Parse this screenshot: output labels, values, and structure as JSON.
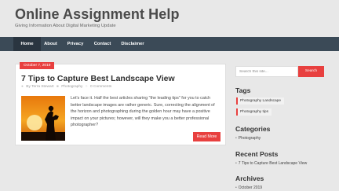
{
  "site": {
    "title": "Online Assignment Help",
    "description": "Giving Information About Digital Marketing Update"
  },
  "nav": {
    "items": [
      {
        "label": "Home"
      },
      {
        "label": "About"
      },
      {
        "label": "Privacy"
      },
      {
        "label": "Contact"
      },
      {
        "label": "Disclaimer"
      }
    ]
  },
  "post": {
    "date": "October 7, 2019",
    "title": "7 Tips to Capture Best Landscape View",
    "author": "By Terra Stewart",
    "category": "Photography",
    "comments": "0 Comments",
    "excerpt": "Let's face it. Half the best articles sharing \"the leading tips\" for you to catch better landscape images are rather generic. Sure, correcting the alignment of the horizon and photographing during the golden hour may have a positive impact on your pictures; however, will they make you a better professional photographer?",
    "read_more": "Read More"
  },
  "sidebar": {
    "search": {
      "placeholder": "Search this site...",
      "button": "Search"
    },
    "tags": {
      "title": "Tags",
      "items": [
        "Photography Landscape",
        "Photography tips"
      ]
    },
    "categories": {
      "title": "Categories",
      "items": [
        "Photography"
      ]
    },
    "recent_posts": {
      "title": "Recent Posts",
      "items": [
        "7 Tips to Capture Best Landscape View"
      ]
    },
    "archives": {
      "title": "Archives",
      "items": [
        "October 2019"
      ]
    }
  },
  "colors": {
    "accent": "#e8403f",
    "nav_bg": "#3b4a57",
    "nav_active": "#2a3540",
    "page_bg": "#e8e8e8"
  },
  "icons": {
    "author": "user-icon",
    "category": "folder-icon",
    "comments": "comment-icon"
  }
}
